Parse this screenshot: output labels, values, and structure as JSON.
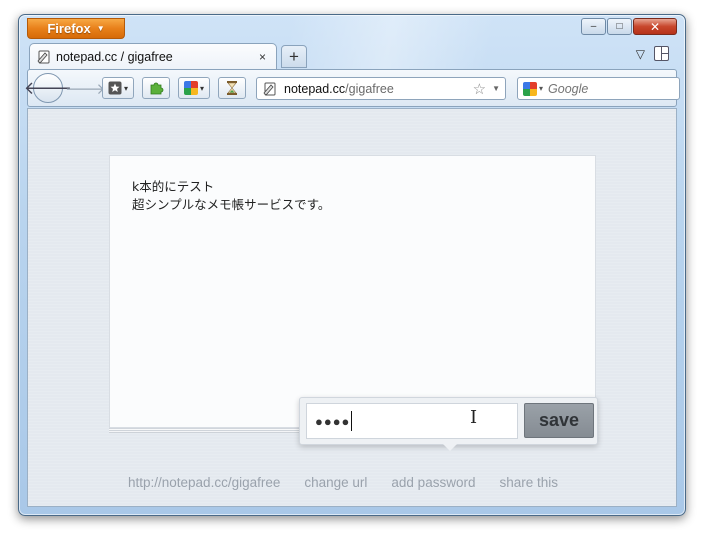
{
  "browser": {
    "menu_button": "Firefox",
    "window_controls": {
      "minimize": "–",
      "maximize": "□",
      "close": "✕"
    },
    "tab": {
      "title": "notepad.cc / gigafree",
      "close": "×"
    },
    "new_tab": "+",
    "tabs_list": "▽",
    "url": {
      "domain": "notepad.cc",
      "path": "/gigafree"
    },
    "search": {
      "placeholder": "Google"
    }
  },
  "page": {
    "note_text": "k本的にテスト\n超シンプルなメモ帳サービスです。",
    "password": {
      "value": "●●●●"
    },
    "save_label": "save",
    "footer": {
      "url_link": "http://notepad.cc/gigafree",
      "change_url": "change url",
      "add_password": "add password",
      "share": "share this"
    }
  },
  "colors": {
    "firefox_button": "#e8801a",
    "window_frame": "#b9d4ee",
    "page_background": "#e4e9ef",
    "save_button": "#858c93",
    "footer_link": "#9aa2ac"
  }
}
